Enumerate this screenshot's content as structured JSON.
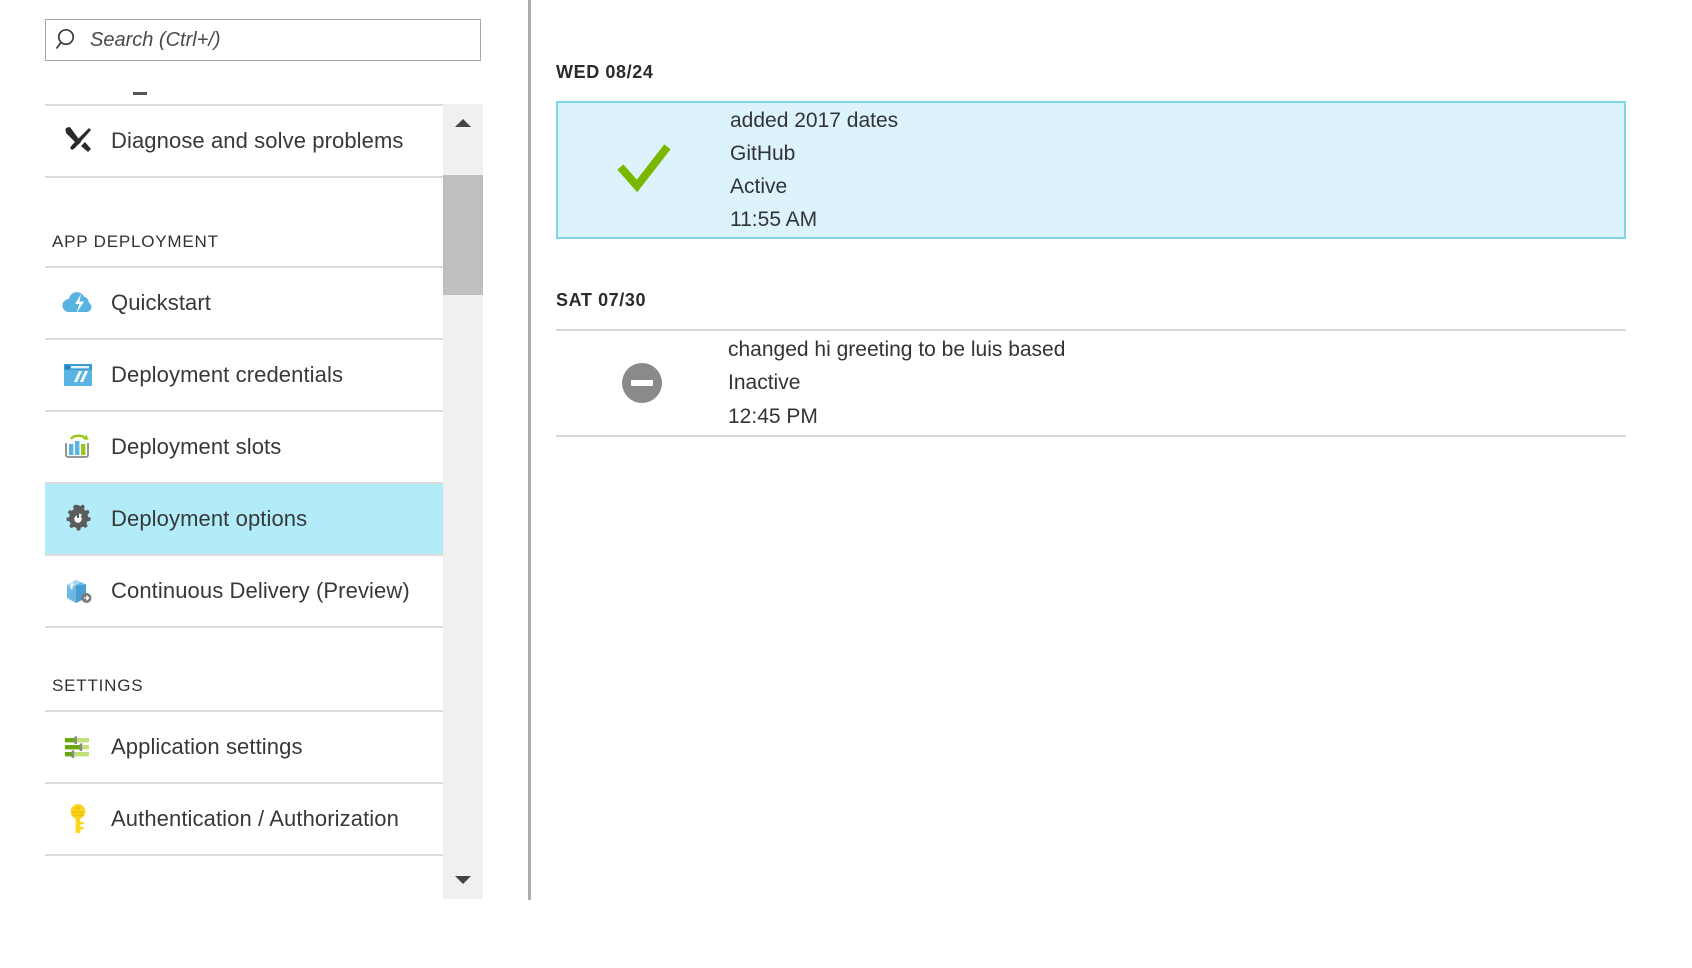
{
  "search": {
    "placeholder": "Search (Ctrl+/)",
    "value": "",
    "icon": "search-icon"
  },
  "sidebar": {
    "items": [
      {
        "label": "Diagnose and solve problems",
        "icon": "wrench-screwdriver-icon",
        "type": "item",
        "selected": false
      },
      {
        "label": "APP DEPLOYMENT",
        "type": "section"
      },
      {
        "label": "Quickstart",
        "icon": "cloud-lightning-icon",
        "type": "item",
        "selected": false
      },
      {
        "label": "Deployment credentials",
        "icon": "browser-window-icon",
        "type": "item",
        "selected": false
      },
      {
        "label": "Deployment slots",
        "icon": "bar-chart-refresh-icon",
        "type": "item",
        "selected": false
      },
      {
        "label": "Deployment options",
        "icon": "gear-icon",
        "type": "item",
        "selected": true
      },
      {
        "label": "Continuous Delivery (Preview)",
        "icon": "package-box-icon",
        "type": "item",
        "selected": false
      },
      {
        "label": "SETTINGS",
        "type": "section"
      },
      {
        "label": "Application settings",
        "icon": "sliders-icon",
        "type": "item",
        "selected": false
      },
      {
        "label": "Authentication / Authorization",
        "icon": "key-icon",
        "type": "item",
        "selected": false
      }
    ],
    "scrollbar": {
      "up_arrow": "chevron-up-icon",
      "down_arrow": "chevron-down-icon"
    }
  },
  "main": {
    "groups": [
      {
        "day": "WED 08/24",
        "entries": [
          {
            "message": "added 2017 dates",
            "source": "GitHub",
            "status": "Active",
            "time": "11:55 AM",
            "status_icon": "checkmark-icon",
            "selected": true
          }
        ]
      },
      {
        "day": "SAT 07/30",
        "entries": [
          {
            "message": "changed hi greeting to be luis based",
            "source": "",
            "status": "Inactive",
            "time": "12:45 PM",
            "status_icon": "minus-circle-icon",
            "selected": false
          }
        ]
      }
    ]
  },
  "colors": {
    "accent": "#b3ecf9",
    "selected_card_bg": "#ddf3fb",
    "selected_card_border": "#7fd4ea",
    "success_green": "#7ab800",
    "inactive_gray": "#8a8a8a",
    "divider": "#dcdcdc",
    "text": "#36393b"
  }
}
